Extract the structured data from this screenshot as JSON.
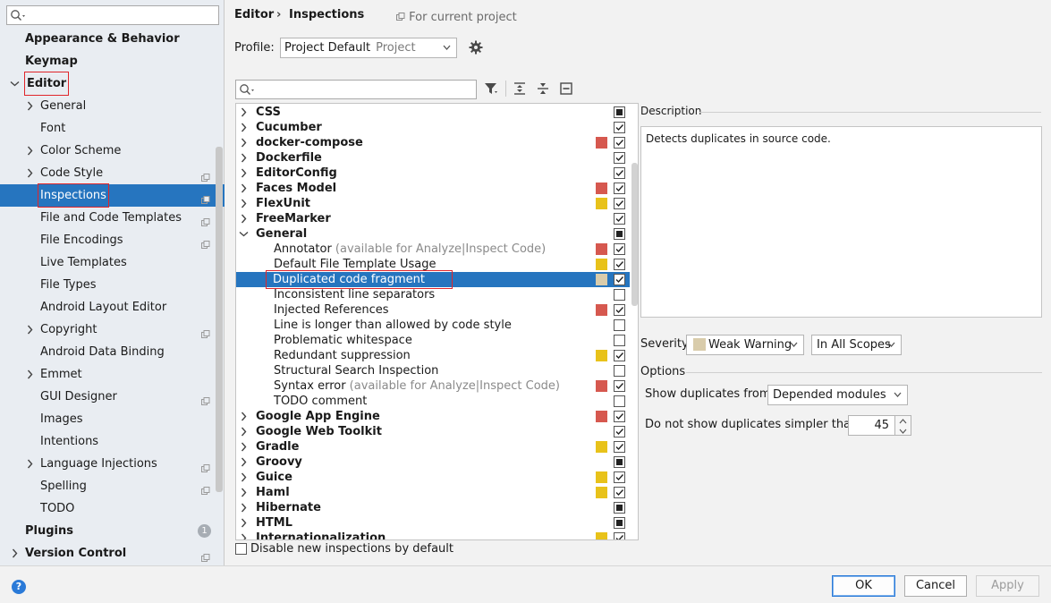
{
  "sidebar": {
    "search_placeholder": "",
    "items": [
      {
        "label": "Appearance & Behavior",
        "level": "top",
        "arrow": "none"
      },
      {
        "label": "Keymap",
        "level": "top",
        "arrow": "none"
      },
      {
        "label": "Editor",
        "level": "top",
        "arrow": "down"
      },
      {
        "label": "General",
        "level": "sub",
        "arrow": "right"
      },
      {
        "label": "Font",
        "level": "sub",
        "arrow": "none"
      },
      {
        "label": "Color Scheme",
        "level": "sub",
        "arrow": "right"
      },
      {
        "label": "Code Style",
        "level": "sub",
        "arrow": "right",
        "scope": true
      },
      {
        "label": "Inspections",
        "level": "sub",
        "arrow": "none",
        "scope": true,
        "selected": true
      },
      {
        "label": "File and Code Templates",
        "level": "sub",
        "arrow": "none",
        "scope": true
      },
      {
        "label": "File Encodings",
        "level": "sub",
        "arrow": "none",
        "scope": true
      },
      {
        "label": "Live Templates",
        "level": "sub",
        "arrow": "none"
      },
      {
        "label": "File Types",
        "level": "sub",
        "arrow": "none"
      },
      {
        "label": "Android Layout Editor",
        "level": "sub",
        "arrow": "none"
      },
      {
        "label": "Copyright",
        "level": "sub",
        "arrow": "right",
        "scope": true
      },
      {
        "label": "Android Data Binding",
        "level": "sub",
        "arrow": "none"
      },
      {
        "label": "Emmet",
        "level": "sub",
        "arrow": "right"
      },
      {
        "label": "GUI Designer",
        "level": "sub",
        "arrow": "none",
        "scope": true
      },
      {
        "label": "Images",
        "level": "sub",
        "arrow": "none"
      },
      {
        "label": "Intentions",
        "level": "sub",
        "arrow": "none"
      },
      {
        "label": "Language Injections",
        "level": "sub",
        "arrow": "right",
        "scope": true
      },
      {
        "label": "Spelling",
        "level": "sub",
        "arrow": "none",
        "scope": true
      },
      {
        "label": "TODO",
        "level": "sub",
        "arrow": "none"
      },
      {
        "label": "Plugins",
        "level": "top",
        "arrow": "none",
        "badge": "1"
      },
      {
        "label": "Version Control",
        "level": "top",
        "arrow": "right",
        "scope": true
      }
    ]
  },
  "breadcrumb": {
    "editor": "Editor",
    "separator": "›",
    "inspections": "Inspections",
    "hint": "For current project"
  },
  "profile": {
    "label": "Profile:",
    "value": "Project Default",
    "kind": "Project"
  },
  "inspection_search_placeholder": "",
  "colors": {
    "error": "#d6584f",
    "warning": "#e8c21a",
    "weak": "#d9ccab",
    "selection": "#2675bf",
    "accent": "#2a7ad8"
  },
  "inspections": [
    {
      "label": "CSS",
      "type": "cat",
      "arrow": "right",
      "sev": "",
      "check": "mixed"
    },
    {
      "label": "Cucumber",
      "type": "cat",
      "arrow": "right",
      "sev": "",
      "check": "checked"
    },
    {
      "label": "docker-compose",
      "type": "cat",
      "arrow": "right",
      "sev": "error",
      "check": "checked"
    },
    {
      "label": "Dockerfile",
      "type": "cat",
      "arrow": "right",
      "sev": "",
      "check": "checked"
    },
    {
      "label": "EditorConfig",
      "type": "cat",
      "arrow": "right",
      "sev": "",
      "check": "checked"
    },
    {
      "label": "Faces Model",
      "type": "cat",
      "arrow": "right",
      "sev": "error",
      "check": "checked"
    },
    {
      "label": "FlexUnit",
      "type": "cat",
      "arrow": "right",
      "sev": "warning",
      "check": "checked"
    },
    {
      "label": "FreeMarker",
      "type": "cat",
      "arrow": "right",
      "sev": "",
      "check": "checked"
    },
    {
      "label": "General",
      "type": "cat",
      "arrow": "down",
      "sev": "",
      "check": "mixed"
    },
    {
      "label": "Annotator",
      "extra": " (available for Analyze|Inspect Code)",
      "type": "child",
      "sev": "error",
      "check": "checked"
    },
    {
      "label": "Default File Template Usage",
      "type": "child",
      "sev": "warning",
      "check": "checked"
    },
    {
      "label": "Duplicated code fragment",
      "type": "child",
      "sev": "weak",
      "check": "checked",
      "selected": true
    },
    {
      "label": "Inconsistent line separators",
      "type": "child",
      "sev": "",
      "check": "unchecked"
    },
    {
      "label": "Injected References",
      "type": "child",
      "sev": "error",
      "check": "checked"
    },
    {
      "label": "Line is longer than allowed by code style",
      "type": "child",
      "sev": "",
      "check": "unchecked"
    },
    {
      "label": "Problematic whitespace",
      "type": "child",
      "sev": "",
      "check": "unchecked"
    },
    {
      "label": "Redundant suppression",
      "type": "child",
      "sev": "warning",
      "check": "checked"
    },
    {
      "label": "Structural Search Inspection",
      "type": "child",
      "sev": "",
      "check": "unchecked"
    },
    {
      "label": "Syntax error",
      "extra": " (available for Analyze|Inspect Code)",
      "type": "child",
      "sev": "error",
      "check": "checked"
    },
    {
      "label": "TODO comment",
      "type": "child",
      "sev": "",
      "check": "unchecked"
    },
    {
      "label": "Google App Engine",
      "type": "cat",
      "arrow": "right",
      "sev": "error",
      "check": "checked"
    },
    {
      "label": "Google Web Toolkit",
      "type": "cat",
      "arrow": "right",
      "sev": "",
      "check": "checked"
    },
    {
      "label": "Gradle",
      "type": "cat",
      "arrow": "right",
      "sev": "warning",
      "check": "checked"
    },
    {
      "label": "Groovy",
      "type": "cat",
      "arrow": "right",
      "sev": "",
      "check": "mixed"
    },
    {
      "label": "Guice",
      "type": "cat",
      "arrow": "right",
      "sev": "warning",
      "check": "checked"
    },
    {
      "label": "Haml",
      "type": "cat",
      "arrow": "right",
      "sev": "warning",
      "check": "checked"
    },
    {
      "label": "Hibernate",
      "type": "cat",
      "arrow": "right",
      "sev": "",
      "check": "mixed"
    },
    {
      "label": "HTML",
      "type": "cat",
      "arrow": "right",
      "sev": "",
      "check": "mixed"
    },
    {
      "label": "Internationalization",
      "type": "cat",
      "arrow": "right",
      "sev": "warning",
      "check": "checked"
    }
  ],
  "disable_new_label": "Disable new inspections by default",
  "description": {
    "title": "Description",
    "text": "Detects duplicates in source code."
  },
  "severity": {
    "label": "Severity:",
    "value": "Weak Warning",
    "scope": "In All Scopes"
  },
  "options": {
    "title": "Options",
    "dup_from_label": "Show duplicates from",
    "dup_from_value": "Depended modules",
    "simpler_label": "Do not show duplicates simpler than:",
    "simpler_value": "45"
  },
  "buttons": {
    "help": "?",
    "ok": "OK",
    "cancel": "Cancel",
    "apply": "Apply"
  }
}
